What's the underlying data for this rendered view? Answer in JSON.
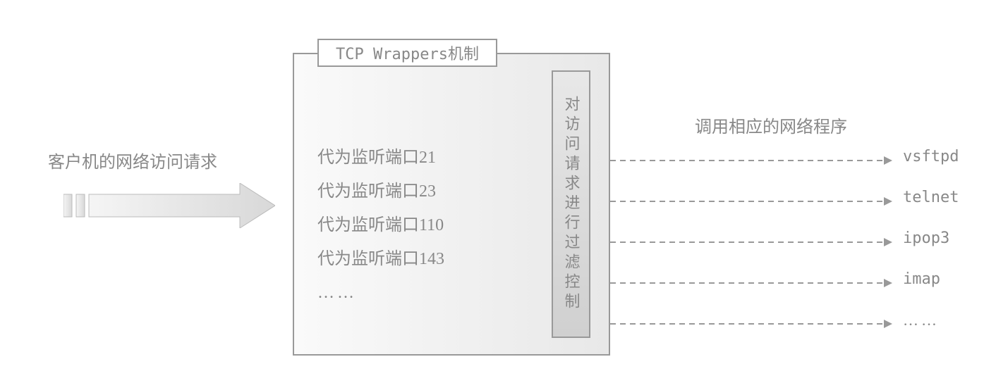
{
  "client_label": "客户机的网络访问请求",
  "title": "TCP Wrappers机制",
  "ports": [
    "代为监听端口21",
    "代为监听端口23",
    "代为监听端口110",
    "代为监听端口143",
    "……"
  ],
  "filter_text": "对访问请求进行过滤控制",
  "invoke_label": "调用相应的网络程序",
  "services": [
    "vsftpd",
    "telnet",
    "ipop3",
    "imap",
    "……"
  ]
}
